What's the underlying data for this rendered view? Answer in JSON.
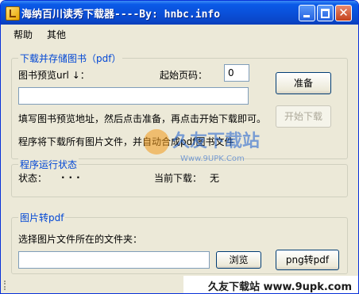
{
  "window": {
    "title": "海纳百川读秀下载器----By: hnbc.info"
  },
  "menu": {
    "items": [
      "帮助",
      "其他"
    ]
  },
  "download_group": {
    "legend": "下载并存储图书（pdf）",
    "url_label": "图书预览url ↓：",
    "start_page_label": "起始页码：",
    "start_page_value": "0",
    "url_value": "",
    "prepare_button": "准备",
    "start_button": "开始下载",
    "instruction": "填写图书预览地址，然后点击准备，再点击开始下载即可。",
    "note": "程序将下载所有图片文件，并自动合成pdf图书文件"
  },
  "status_group": {
    "legend": "程序运行状态",
    "status_label": "状态：",
    "status_value": "...",
    "current_label": "当前下载：",
    "current_value": "无"
  },
  "convert_group": {
    "legend": "图片转pdf",
    "folder_label": "选择图片文件所在的文件夹：",
    "folder_value": "",
    "browse_button": "浏览",
    "convert_button": "png转pdf"
  },
  "watermark": {
    "logo_text": "久友下载站",
    "logo_url": "Www.9UPK.Com",
    "footer": "久友下载站 www.9upk.com"
  },
  "colors": {
    "title_bar": "#0a4fd8",
    "legend_text": "#0046d5",
    "window_bg": "#ece9d8"
  }
}
